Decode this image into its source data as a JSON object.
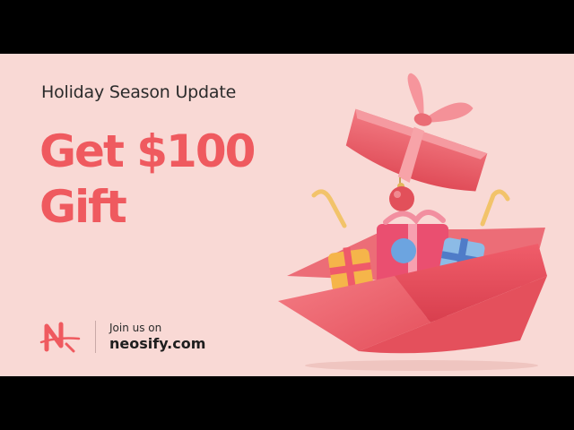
{
  "promo": {
    "kicker": "Holiday Season Update",
    "headline_line1": "Get $100",
    "headline_line2": "Gift"
  },
  "brand": {
    "join_label": "Join us on",
    "site": "neosify.com",
    "logo_icon": "neosify-n-logo-icon"
  },
  "colors": {
    "background": "#f9d9d5",
    "accent": "#ef5a5f",
    "letterbox": "#000000"
  },
  "illustration": {
    "icon": "open-gift-box-icon"
  }
}
